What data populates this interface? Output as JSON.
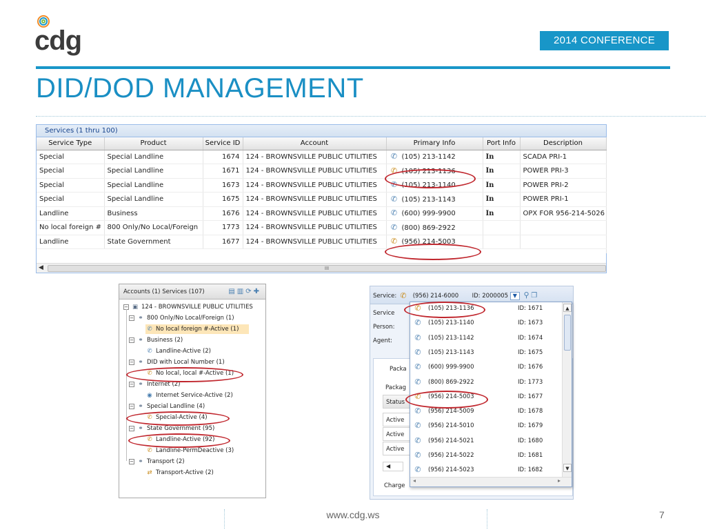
{
  "header": {
    "logo_text": "cdg",
    "conference": "2014 CONFERENCE",
    "title": "DID/DOD MANAGEMENT"
  },
  "colors": {
    "accent": "#1896c8",
    "highlight_oval": "#c0262d",
    "selected_row": "#fde6b8"
  },
  "grid": {
    "caption": "Services (1 thru 100)",
    "columns": [
      "Service Type",
      "Product",
      "Service ID",
      "Account",
      "Primary Info",
      "Port Info",
      "Description"
    ],
    "rows": [
      {
        "type": "Special",
        "product": "Special Landline",
        "id": "1674",
        "account": "124 - BROWNSVILLE PUBLIC UTILITIES",
        "phone": "(105) 213-1142",
        "icon": "phone-icon",
        "port": "In",
        "desc": "SCADA PRI-1"
      },
      {
        "type": "Special",
        "product": "Special Landline",
        "id": "1671",
        "account": "124 - BROWNSVILLE PUBLIC UTILITIES",
        "phone": "(105) 213-1136",
        "icon": "multi-phone-icon",
        "port": "In",
        "desc": "POWER PRI-3"
      },
      {
        "type": "Special",
        "product": "Special Landline",
        "id": "1673",
        "account": "124 - BROWNSVILLE PUBLIC UTILITIES",
        "phone": "(105) 213-1140",
        "icon": "phone-icon",
        "port": "In",
        "desc": "POWER PRI-2"
      },
      {
        "type": "Special",
        "product": "Special Landline",
        "id": "1675",
        "account": "124 - BROWNSVILLE PUBLIC UTILITIES",
        "phone": "(105) 213-1143",
        "icon": "phone-icon",
        "port": "In",
        "desc": "POWER PRI-1"
      },
      {
        "type": "Landline",
        "product": "Business",
        "id": "1676",
        "account": "124 - BROWNSVILLE PUBLIC UTILITIES",
        "phone": "(600) 999-9900",
        "icon": "phone-icon",
        "port": "In",
        "desc": "OPX FOR 956-214-5026"
      },
      {
        "type": "No local foreign #",
        "product": "800 Only/No Local/Foreign",
        "id": "1773",
        "account": "124 - BROWNSVILLE PUBLIC UTILITIES",
        "phone": "(800) 869-2922",
        "icon": "phone-icon",
        "port": "",
        "desc": ""
      },
      {
        "type": "Landline",
        "product": "State Government",
        "id": "1677",
        "account": "124 - BROWNSVILLE PUBLIC UTILITIES",
        "phone": "(956) 214-5003",
        "icon": "multi-phone-icon",
        "port": "",
        "desc": ""
      }
    ],
    "scroll_label": "III"
  },
  "tree": {
    "header": "Accounts (1) Services (107)",
    "nodes": [
      {
        "label": "124 - BROWNSVILLE PUBLIC UTILITIES",
        "icon": "account-icon"
      },
      {
        "label": "800 Only/No Local/Foreign (1)",
        "icon": "group-icon"
      },
      {
        "label": "No local foreign #-Active (1)",
        "icon": "phone-icon",
        "selected": true
      },
      {
        "label": "Business (2)",
        "icon": "group-icon"
      },
      {
        "label": "Landline-Active (2)",
        "icon": "phone-icon"
      },
      {
        "label": "DID with Local Number (1)",
        "icon": "group-icon"
      },
      {
        "label": "No local, local #-Active (1)",
        "icon": "multi-phone-icon"
      },
      {
        "label": "Internet (2)",
        "icon": "group-icon"
      },
      {
        "label": "Internet Service-Active (2)",
        "icon": "globe-icon"
      },
      {
        "label": "Special Landline (4)",
        "icon": "group-icon"
      },
      {
        "label": "Special-Active (4)",
        "icon": "multi-phone-icon"
      },
      {
        "label": "State Government (95)",
        "icon": "group-icon"
      },
      {
        "label": "Landline-Active (92)",
        "icon": "multi-phone-icon"
      },
      {
        "label": "Landline-PermDeactive (3)",
        "icon": "deactive-phone-icon"
      },
      {
        "label": "Transport (2)",
        "icon": "group-icon"
      },
      {
        "label": "Transport-Active (2)",
        "icon": "transport-icon"
      }
    ]
  },
  "service_panel": {
    "label": "Service:",
    "phone": "(956) 214-6000",
    "id_text": "ID: 2000005",
    "side_labels": [
      "Service",
      "Person:",
      "Agent:"
    ],
    "packa": "Packa",
    "packag": "Packag",
    "status": "Status",
    "actives": [
      "Active",
      "Active",
      "Active"
    ],
    "charge": "Charge",
    "dropdown": [
      {
        "phone": "(105) 213-1136",
        "id": "ID: 1671",
        "icon": "multi-phone-icon"
      },
      {
        "phone": "(105) 213-1140",
        "id": "ID: 1673",
        "icon": "phone-icon"
      },
      {
        "phone": "(105) 213-1142",
        "id": "ID: 1674",
        "icon": "phone-icon"
      },
      {
        "phone": "(105) 213-1143",
        "id": "ID: 1675",
        "icon": "phone-icon"
      },
      {
        "phone": "(600) 999-9900",
        "id": "ID: 1676",
        "icon": "phone-icon"
      },
      {
        "phone": "(800) 869-2922",
        "id": "ID: 1773",
        "icon": "phone-icon"
      },
      {
        "phone": "(956) 214-5003",
        "id": "ID: 1677",
        "icon": "multi-phone-icon"
      },
      {
        "phone": "(956) 214-5009",
        "id": "ID: 1678",
        "icon": "phone-icon"
      },
      {
        "phone": "(956) 214-5010",
        "id": "ID: 1679",
        "icon": "phone-icon"
      },
      {
        "phone": "(956) 214-5021",
        "id": "ID: 1680",
        "icon": "phone-icon"
      },
      {
        "phone": "(956) 214-5022",
        "id": "ID: 1681",
        "icon": "phone-icon"
      },
      {
        "phone": "(956) 214-5023",
        "id": "ID: 1682",
        "icon": "phone-icon"
      }
    ]
  },
  "footer": {
    "url": "www.cdg.ws",
    "page": "7"
  }
}
